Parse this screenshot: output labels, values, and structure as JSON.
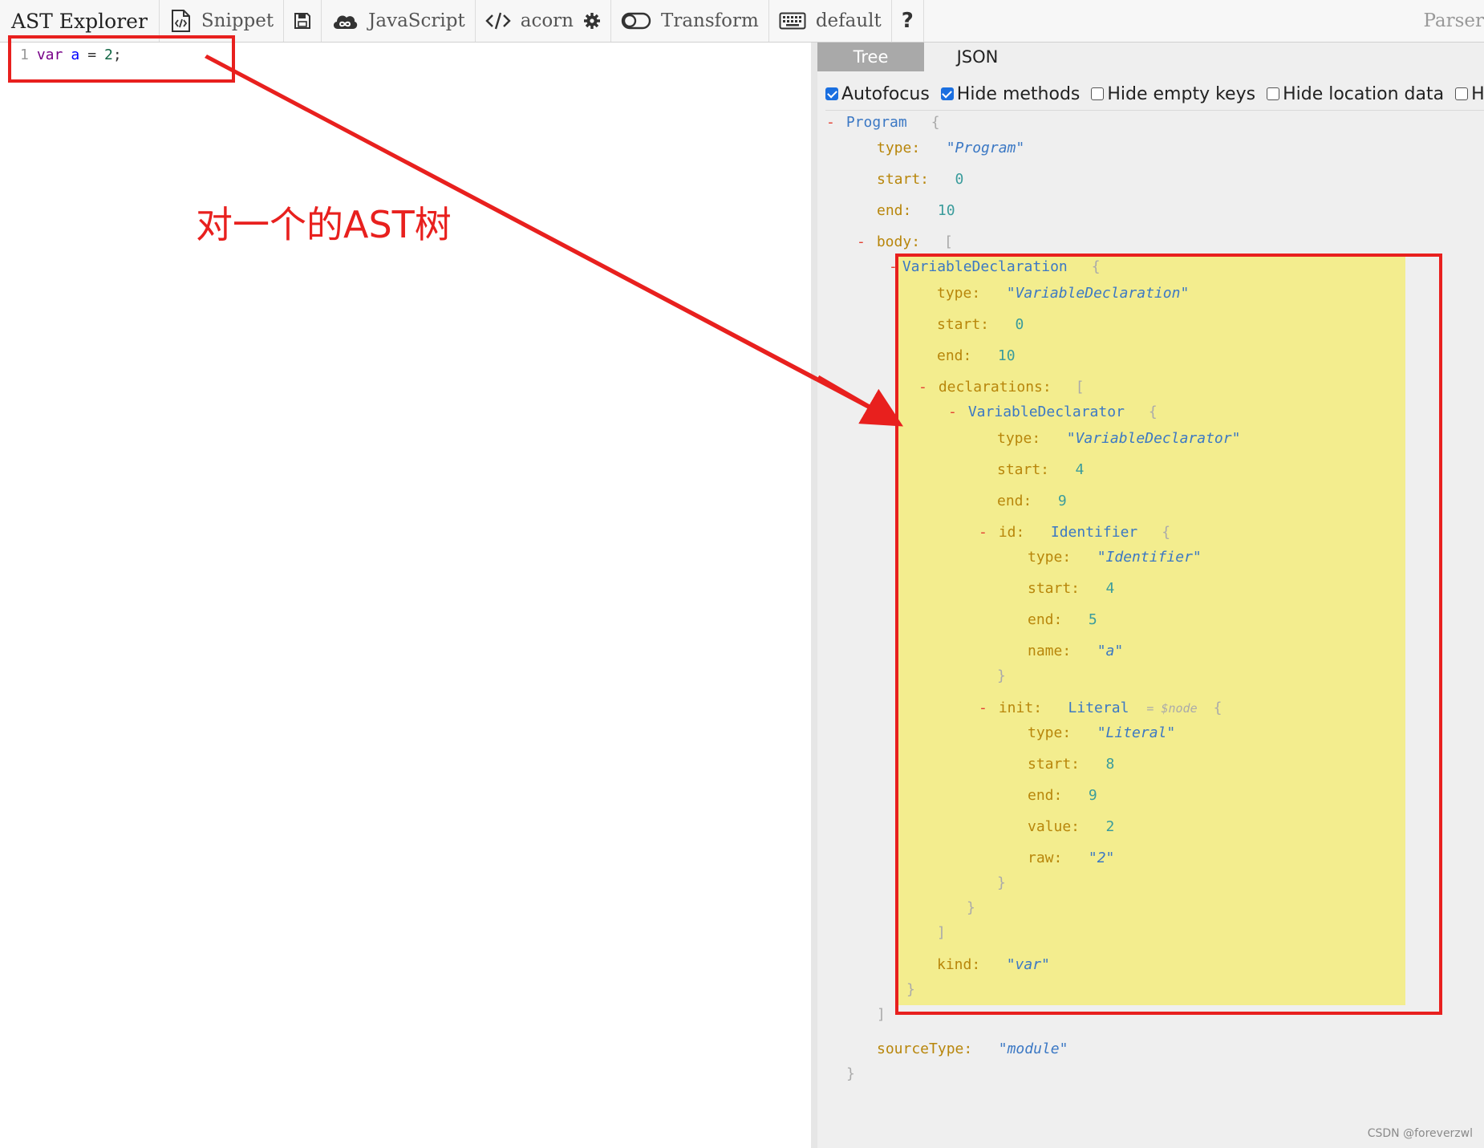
{
  "toolbar": {
    "title": "AST Explorer",
    "snippet_label": "Snippet",
    "language_label": "JavaScript",
    "parser_label": "acorn",
    "transform_label": "Transform",
    "keymap_label": "default",
    "help_label": "?",
    "right_label": "Parser",
    "icons": {
      "snippet": "file-code-icon",
      "save": "save-icon",
      "language": "cloud-icon",
      "parser": "code-brackets-icon",
      "settings": "gear-icon",
      "transform": "toggle-icon",
      "keymap": "keyboard-icon"
    }
  },
  "editor": {
    "line_number": "1",
    "tokens": {
      "keyword": "var",
      "identifier": "a",
      "operator": "=",
      "number": "2",
      "punct": ";"
    }
  },
  "output": {
    "tabs": [
      {
        "label": "Tree",
        "active": true
      },
      {
        "label": "JSON",
        "active": false
      }
    ],
    "options": [
      {
        "label": "Autofocus",
        "checked": true
      },
      {
        "label": "Hide methods",
        "checked": true
      },
      {
        "label": "Hide empty keys",
        "checked": false
      },
      {
        "label": "Hide location data",
        "checked": false
      },
      {
        "label": "Hid",
        "checked": false
      }
    ]
  },
  "tree": {
    "program": {
      "name": "Program",
      "type_key": "type:",
      "type_val": "\"Program\"",
      "start_key": "start:",
      "start_val": "0",
      "end_key": "end:",
      "end_val": "10",
      "body_key": "body:",
      "sourcetype_key": "sourceType:",
      "sourcetype_val": "\"module\""
    },
    "decl": {
      "name": "VariableDeclaration",
      "type_key": "type:",
      "type_val": "\"VariableDeclaration\"",
      "start_key": "start:",
      "start_val": "0",
      "end_key": "end:",
      "end_val": "10",
      "decls_key": "declarations:",
      "kind_key": "kind:",
      "kind_val": "\"var\""
    },
    "declarator": {
      "name": "VariableDeclarator",
      "type_key": "type:",
      "type_val": "\"VariableDeclarator\"",
      "start_key": "start:",
      "start_val": "4",
      "end_key": "end:",
      "end_val": "9"
    },
    "id": {
      "key": "id:",
      "name": "Identifier",
      "type_key": "type:",
      "type_val": "\"Identifier\"",
      "start_key": "start:",
      "start_val": "4",
      "end_key": "end:",
      "end_val": "5",
      "name_key": "name:",
      "name_val": "\"a\""
    },
    "init": {
      "key": "init:",
      "name": "Literal",
      "hint": "= $node",
      "type_key": "type:",
      "type_val": "\"Literal\"",
      "start_key": "start:",
      "start_val": "8",
      "end_key": "end:",
      "end_val": "9",
      "value_key": "value:",
      "value_val": "2",
      "raw_key": "raw:",
      "raw_val": "\"2\""
    },
    "toggle": "-",
    "open_brace": "{",
    "close_brace": "}",
    "open_bracket": "[",
    "close_bracket": "]"
  },
  "annotation": {
    "text": "对一个的AST树",
    "color": "#e8201e"
  },
  "watermark": "CSDN @foreverzwl",
  "colors": {
    "highlight": "#f3ed8e",
    "checkbox": "#1a6fe0",
    "node_name": "#3b78c4",
    "key": "#b8860b",
    "toggle": "#e34234"
  }
}
